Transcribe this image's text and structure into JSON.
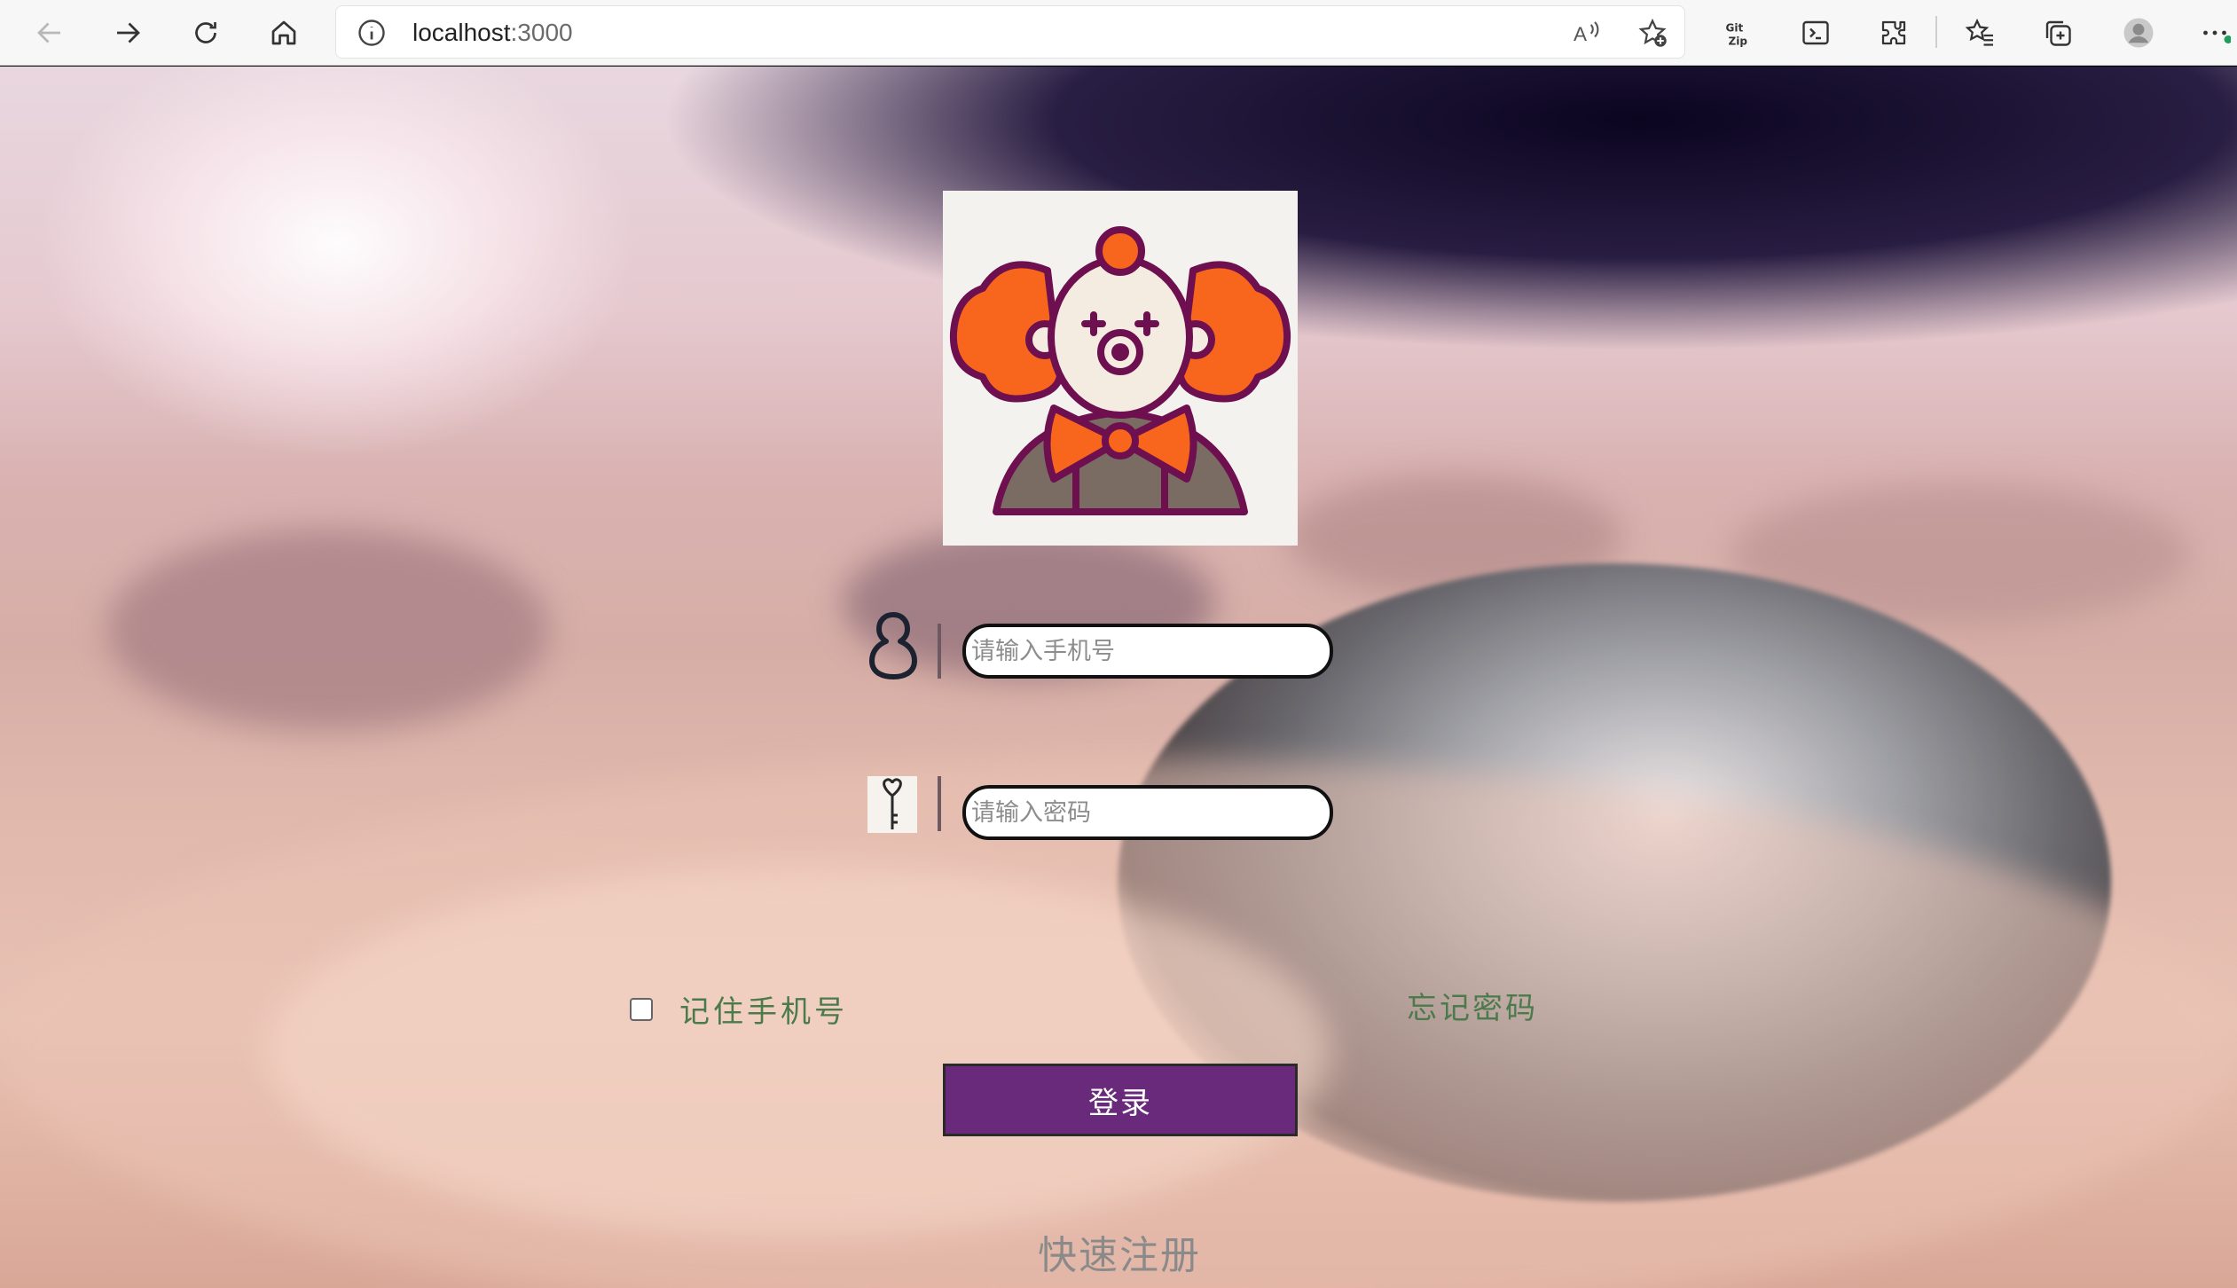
{
  "browser": {
    "url_host": "localhost",
    "url_port": ":3000",
    "icons": {
      "back": "back-arrow-icon",
      "forward": "forward-arrow-icon",
      "refresh": "refresh-icon",
      "home": "home-icon",
      "site_info": "info-icon",
      "read_aloud": "read-aloud-icon",
      "add_favorite": "add-favorite-icon",
      "git_zip": "git-zip-icon",
      "terminal": "terminal-icon",
      "extensions": "extensions-icon",
      "favorites": "favorites-icon",
      "collections": "collections-icon",
      "profile": "profile-avatar-icon",
      "more": "more-icon"
    },
    "git_zip_text_top": "Git",
    "git_zip_text_bottom": "Zip"
  },
  "login": {
    "phone_placeholder": "请输入手机号",
    "password_placeholder": "请输入密码",
    "remember_label": "记住手机号",
    "forgot_label": "忘记密码",
    "login_button": "登录",
    "register_link": "快速注册"
  },
  "colors": {
    "login_button": "#6a2a7c",
    "link_text": "#4b7a4b",
    "clown_orange": "#f7661c",
    "clown_outline": "#6e0f4f"
  }
}
